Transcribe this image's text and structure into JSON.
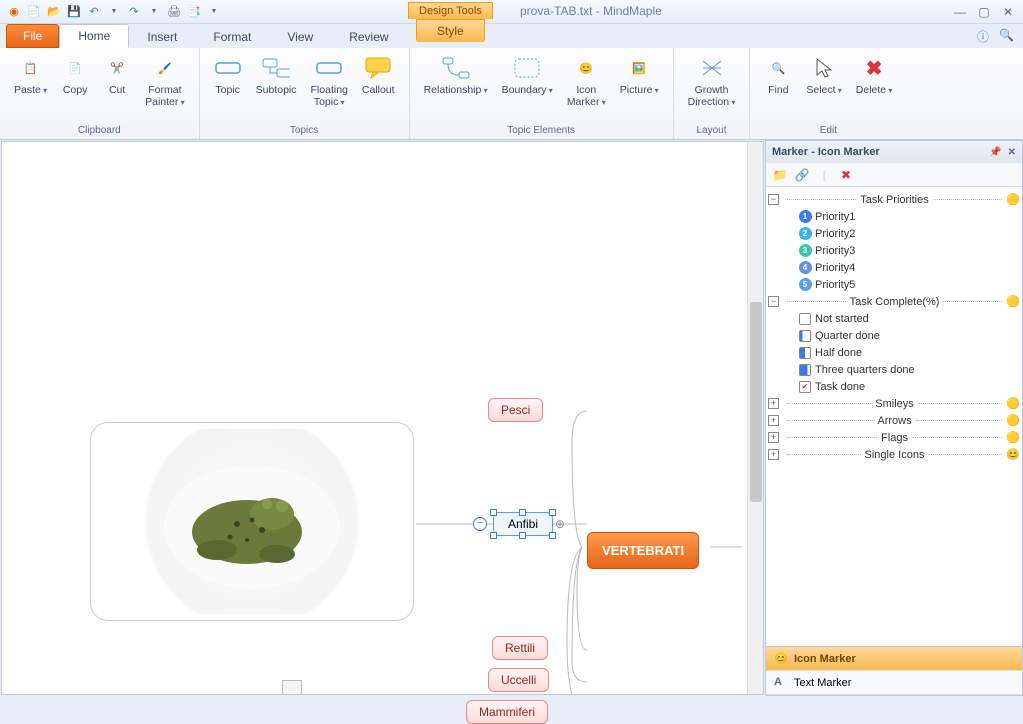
{
  "window": {
    "doc_title": "prova-TAB.txt - MindMaple",
    "design_tools_label": "Design Tools"
  },
  "tabs": {
    "file": "File",
    "home": "Home",
    "insert": "Insert",
    "format": "Format",
    "view": "View",
    "review": "Review",
    "tools": "Tools",
    "style": "Style"
  },
  "ribbon": {
    "clipboard": {
      "label": "Clipboard",
      "paste": "Paste",
      "copy": "Copy",
      "cut": "Cut",
      "format_painter": "Format\nPainter"
    },
    "topics": {
      "label": "Topics",
      "topic": "Topic",
      "subtopic": "Subtopic",
      "floating": "Floating\nTopic",
      "callout": "Callout"
    },
    "elements": {
      "label": "Topic Elements",
      "relationship": "Relationship",
      "boundary": "Boundary",
      "icon_marker": "Icon\nMarker",
      "picture": "Picture"
    },
    "layout": {
      "label": "Layout",
      "growth": "Growth\nDirection"
    },
    "edit": {
      "label": "Edit",
      "find": "Find",
      "select": "Select",
      "delete": "Delete"
    }
  },
  "mindmap": {
    "root": "VERTEBRATI",
    "nodes": {
      "pesci": "Pesci",
      "anfibi": "Anfibi",
      "rettili": "Rettili",
      "uccelli": "Uccelli",
      "mammiferi": "Mammiferi"
    }
  },
  "panel": {
    "title": "Marker - Icon Marker",
    "groups": {
      "priorities": {
        "label": "Task Priorities",
        "items": [
          "Priority1",
          "Priority2",
          "Priority3",
          "Priority4",
          "Priority5"
        ]
      },
      "complete": {
        "label": "Task Complete(%)",
        "items": [
          "Not started",
          "Quarter done",
          "Half done",
          "Three quarters done",
          "Task done"
        ]
      },
      "smileys": "Smileys",
      "arrows": "Arrows",
      "flags": "Flags",
      "single": "Single Icons"
    },
    "bottom_tabs": {
      "icon": "Icon Marker",
      "text": "Text Marker"
    }
  }
}
